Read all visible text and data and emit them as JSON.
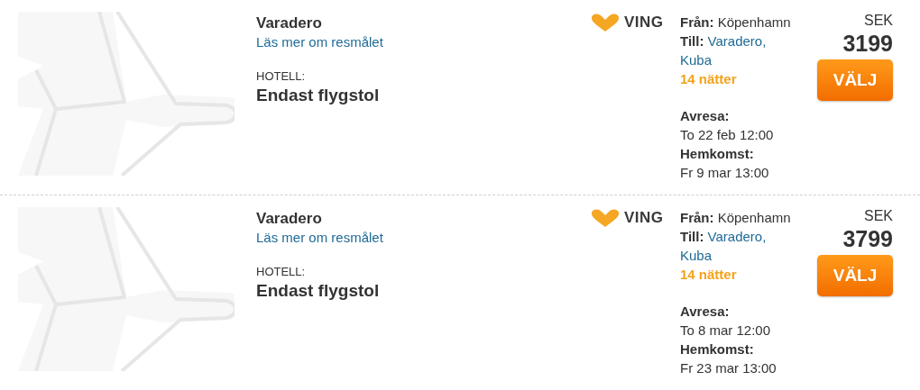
{
  "results": [
    {
      "destination": "Varadero",
      "link": "Läs mer om resmålet",
      "hotel_label": "HOTELL:",
      "hotel": "Endast flygstol",
      "brand": "VING",
      "from_label": "Från:",
      "from": "Köpenhamn",
      "to_label": "Till:",
      "to": "Varadero, Kuba",
      "nights": "14 nätter",
      "departure_label": "Avresa:",
      "departure": "To 22 feb 12:00",
      "return_label": "Hemkomst:",
      "return": "Fr 9 mar 13:00",
      "currency": "SEK",
      "price": "3199",
      "button": "VÄLJ"
    },
    {
      "destination": "Varadero",
      "link": "Läs mer om resmålet",
      "hotel_label": "HOTELL:",
      "hotel": "Endast flygstol",
      "brand": "VING",
      "from_label": "Från:",
      "from": "Köpenhamn",
      "to_label": "Till:",
      "to": "Varadero, Kuba",
      "nights": "14 nätter",
      "departure_label": "Avresa:",
      "departure": "To 8 mar 12:00",
      "return_label": "Hemkomst:",
      "return": "Fr 23 mar 13:00",
      "currency": "SEK",
      "price": "3799",
      "button": "VÄLJ"
    }
  ]
}
